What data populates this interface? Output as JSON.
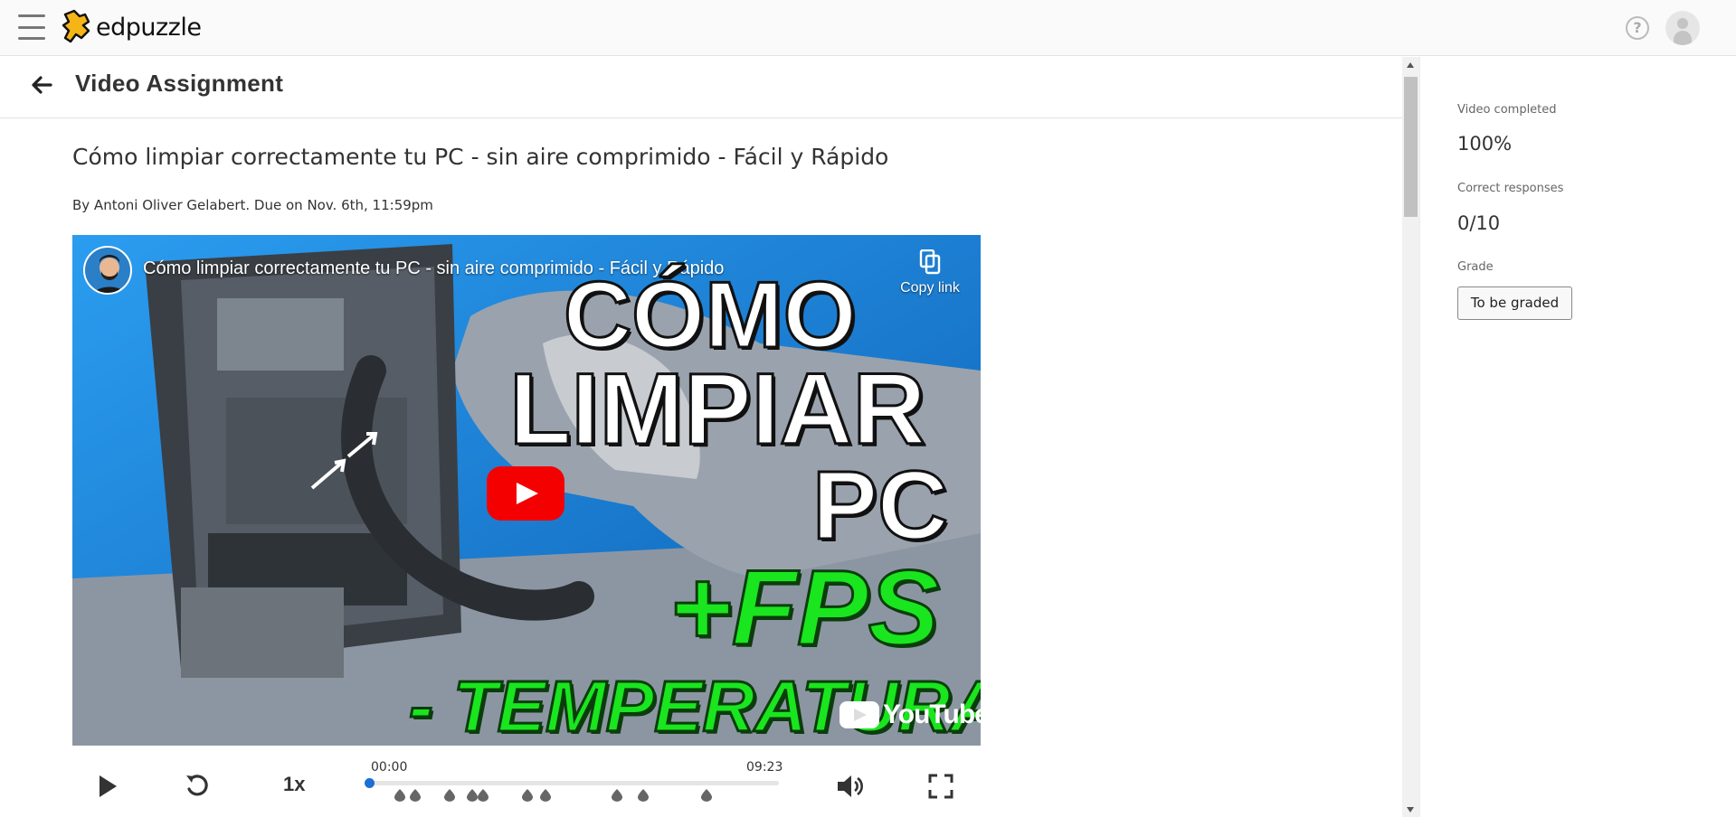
{
  "app": {
    "name": "edpuzzle"
  },
  "header": {
    "menu_icon": "hamburger-menu-icon",
    "help_icon": "question-icon",
    "help_glyph": "?",
    "avatar_icon": "user-avatar-icon"
  },
  "assignment": {
    "page_title": "Video Assignment",
    "back_icon": "arrow-left-icon",
    "video_title": "Cómo limpiar correctamente tu PC - sin aire comprimido - Fácil y Rápido",
    "byline": "By Antoni Oliver Gelabert. Due on Nov. 6th, 11:59pm"
  },
  "video": {
    "embed_title": "Cómo limpiar correctamente tu PC - sin aire comprimido - Fácil y Rápido",
    "copy_link_label": "Copy link",
    "thumbnail_text": [
      "CÓMO",
      "LIMPIAR",
      "PC",
      "+FPS",
      "- TEMPERATURA"
    ],
    "youtube_label": "YouTube",
    "accent_red": "#f40000",
    "accent_green": "#19e61e"
  },
  "controls": {
    "speed": "1x",
    "time_current": "00:00",
    "time_total": "09:23",
    "progress_fraction": 0.0,
    "play_icon": "play-icon",
    "rewind_icon": "rewind-icon",
    "volume_icon": "volume-icon",
    "fullscreen_icon": "fullscreen-icon",
    "question_markers_count": 10,
    "progress_color": "#1c6fd6"
  },
  "stats": {
    "video_completed_label": "Video completed",
    "video_completed_value": "100%",
    "correct_responses_label": "Correct responses",
    "correct_responses_value": "0/10",
    "grade_label": "Grade",
    "grade_value": "To be graded"
  }
}
